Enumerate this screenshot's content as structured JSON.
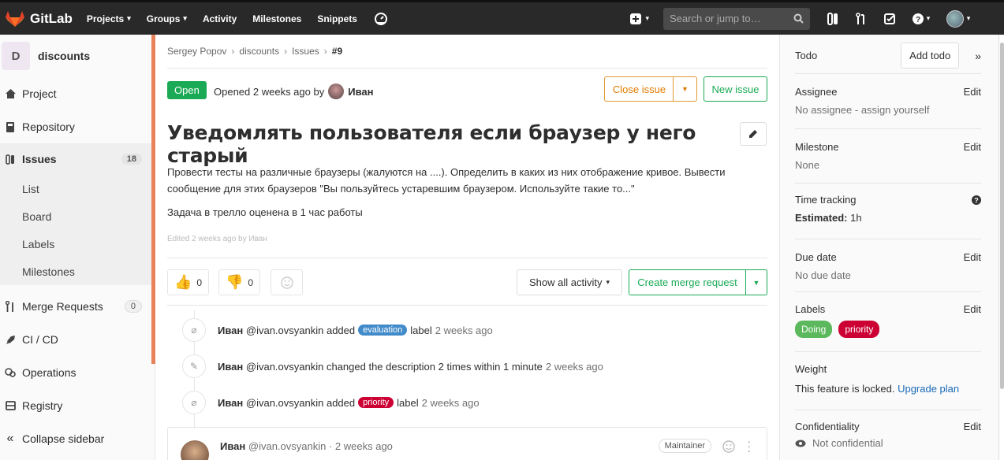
{
  "topnav": {
    "brand": "GitLab",
    "links": [
      {
        "label": "Projects",
        "caret": true
      },
      {
        "label": "Groups",
        "caret": true
      },
      {
        "label": "Activity",
        "caret": false
      },
      {
        "label": "Milestones",
        "caret": false
      },
      {
        "label": "Snippets",
        "caret": false
      }
    ],
    "search_placeholder": "Search or jump to…",
    "icons": [
      "gauge-icon",
      "plus-square-icon",
      "search-icon",
      "issues-icon",
      "merge-request-icon",
      "todo-check-icon",
      "help-icon",
      "user-avatar"
    ]
  },
  "sidebar": {
    "project_initial": "D",
    "project_name": "discounts",
    "items": [
      {
        "label": "Project",
        "icon": "home-icon"
      },
      {
        "label": "Repository",
        "icon": "book-icon"
      },
      {
        "label": "Issues",
        "icon": "issues-icon",
        "badge": "18",
        "active": true
      },
      {
        "label": "Merge Requests",
        "icon": "merge-request-icon",
        "badge": "0"
      },
      {
        "label": "CI / CD",
        "icon": "rocket-icon"
      },
      {
        "label": "Operations",
        "icon": "cloud-gear-icon"
      },
      {
        "label": "Registry",
        "icon": "container-icon"
      }
    ],
    "subitems": [
      "List",
      "Board",
      "Labels",
      "Milestones"
    ],
    "collapse": "Collapse sidebar"
  },
  "breadcrumb": {
    "items": [
      "Sergey Popov",
      "discounts",
      "Issues"
    ],
    "current": "#9"
  },
  "issue": {
    "status": "Open",
    "opened_text": "Opened 2 weeks ago by",
    "author": "Иван",
    "close_label": "Close issue",
    "new_label": "New issue",
    "title": "Уведомлять пользователя если браузер у него старый",
    "description": "Провести тесты на различные браузеры (жалуются на ....). Определить в каких из них отображение кривое. Вывести сообщение для этих браузеров \"Вы пользуйтесь устаревшим браузером. Используйте такие то...\"",
    "description2": "Задача в трелло оценена в 1 час работы",
    "edited": "Edited 2 weeks ago by Иван",
    "thumbs_up": "0",
    "thumbs_down": "0",
    "activity_filter": "Show all activity",
    "create_mr": "Create merge request"
  },
  "timeline": [
    {
      "user": "Иван",
      "handle": "@ivan.ovsyankin",
      "pre": "added",
      "label": "evaluation",
      "label_color": "#428bca",
      "post": "label",
      "time": "2 weeks ago",
      "icon": "tag-icon"
    },
    {
      "user": "Иван",
      "handle": "@ivan.ovsyankin",
      "pre": "changed the description 2 times within 1 minute",
      "label": "",
      "label_color": "",
      "post": "",
      "time": "2 weeks ago",
      "icon": "pencil-square-icon"
    },
    {
      "user": "Иван",
      "handle": "@ivan.ovsyankin",
      "pre": "added",
      "label": "priority",
      "label_color": "#cc0033",
      "post": "label",
      "time": "2 weeks ago",
      "icon": "tag-icon"
    }
  ],
  "comment": {
    "user": "Иван",
    "handle": "@ivan.ovsyankin",
    "time": "· 2 weeks ago",
    "role": "Maintainer"
  },
  "right": {
    "todo": "Todo",
    "add_todo": "Add todo",
    "assignee_title": "Assignee",
    "assignee_value": "No assignee - assign yourself",
    "milestone_title": "Milestone",
    "milestone_value": "None",
    "time_title": "Time tracking",
    "estimated_label": "Estimated:",
    "estimated_value": "1h",
    "due_title": "Due date",
    "due_value": "No due date",
    "labels_title": "Labels",
    "labels": [
      {
        "name": "Doing",
        "color": "#5cb85c"
      },
      {
        "name": "priority",
        "color": "#cc0033"
      }
    ],
    "weight_title": "Weight",
    "weight_locked": "This feature is locked.",
    "weight_upgrade": "Upgrade plan",
    "conf_title": "Confidentiality",
    "conf_value": "Not confidential",
    "edit": "Edit"
  }
}
